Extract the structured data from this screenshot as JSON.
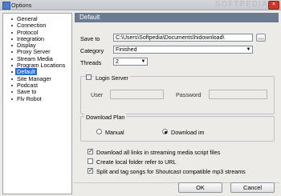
{
  "window": {
    "title": "Options",
    "close_glyph": "×",
    "watermark": "SOFTPEDIA"
  },
  "sidebar": {
    "items": [
      {
        "label": "General"
      },
      {
        "label": "Connection"
      },
      {
        "label": "Protocol"
      },
      {
        "label": "Integration"
      },
      {
        "label": "Display"
      },
      {
        "label": "Proxy Server"
      },
      {
        "label": "Stream Media"
      },
      {
        "label": "Program Locations"
      },
      {
        "label": "Default",
        "selected": true
      },
      {
        "label": "Site Manager"
      },
      {
        "label": "Podcast"
      },
      {
        "label": "Save to"
      },
      {
        "label": "Flv Robot"
      }
    ]
  },
  "panel": {
    "header": "Default",
    "save_to": {
      "label": "Save to",
      "value": "C:\\Users\\Softpedia\\Documents\\hidownload\\",
      "browse_label": "..."
    },
    "category": {
      "label": "Category",
      "value": "Finished"
    },
    "threads": {
      "label": "Threads",
      "value": "2"
    },
    "login": {
      "checkbox_label": "Login Server",
      "user_label": "User",
      "password_label": "Password"
    },
    "download_plan": {
      "title": "Download Plan",
      "options": [
        {
          "label": "Manual",
          "selected": false
        },
        {
          "label": "Download im",
          "selected": true
        }
      ]
    },
    "checks": [
      {
        "label": "Download all links in streaming media script files",
        "checked": true
      },
      {
        "label": "Create local folder refer to URL",
        "checked": false
      },
      {
        "label": "Split and tag songs for Shoutcast compatible mp3 streams",
        "checked": true
      }
    ]
  },
  "footer": {
    "ok_label": "OK",
    "cancel_label": "Cancel"
  },
  "colors": {
    "header_bg": "#6b7c92",
    "selected_bg": "#2b6fd6"
  }
}
